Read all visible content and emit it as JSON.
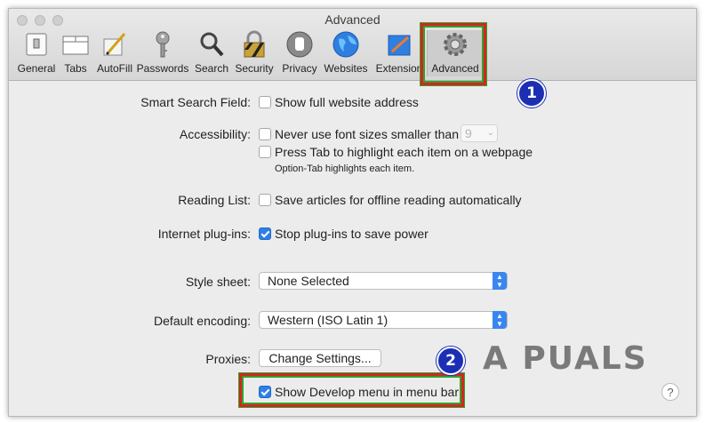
{
  "window": {
    "title": "Advanced"
  },
  "toolbar": {
    "items": [
      {
        "label": "General",
        "icon": "general-icon"
      },
      {
        "label": "Tabs",
        "icon": "tabs-icon"
      },
      {
        "label": "AutoFill",
        "icon": "autofill-icon"
      },
      {
        "label": "Passwords",
        "icon": "key-icon"
      },
      {
        "label": "Search",
        "icon": "magnifier-icon"
      },
      {
        "label": "Security",
        "icon": "lock-icon"
      },
      {
        "label": "Privacy",
        "icon": "hand-icon"
      },
      {
        "label": "Websites",
        "icon": "globe-icon"
      },
      {
        "label": "Extensions",
        "icon": "puzzle-icon"
      },
      {
        "label": "Advanced",
        "icon": "gear-icon"
      }
    ],
    "shown_labels": [
      "General",
      "Tabs",
      "AutoFill",
      "Passwords",
      "Search",
      "Security",
      "Privacy",
      "Websites",
      "Extension",
      "Advanced"
    ]
  },
  "settings": {
    "smart_search": {
      "label": "Smart Search Field:",
      "option": "Show full website address",
      "checked": false
    },
    "accessibility": {
      "label": "Accessibility:",
      "font_option": "Never use font sizes smaller than",
      "font_size": "9",
      "tab_option": "Press Tab to highlight each item on a webpage",
      "tab_hint": "Option-Tab highlights each item."
    },
    "reading_list": {
      "label": "Reading List:",
      "option": "Save articles for offline reading automatically",
      "checked": false
    },
    "plugins": {
      "label": "Internet plug-ins:",
      "option": "Stop plug-ins to save power",
      "checked": true
    },
    "style_sheet": {
      "label": "Style sheet:",
      "value": "None Selected"
    },
    "encoding": {
      "label": "Default encoding:",
      "value": "Western (ISO Latin 1)"
    },
    "proxies": {
      "label": "Proxies:",
      "button": "Change Settings..."
    },
    "develop": {
      "option": "Show Develop menu in menu bar",
      "checked": true
    }
  },
  "annotations": {
    "badge1": "1",
    "badge2": "2",
    "highlight_color": "#d2261f",
    "badge_color": "#1c2fb4"
  },
  "watermark": {
    "text": "A PUALS"
  },
  "help": {
    "glyph": "?"
  }
}
